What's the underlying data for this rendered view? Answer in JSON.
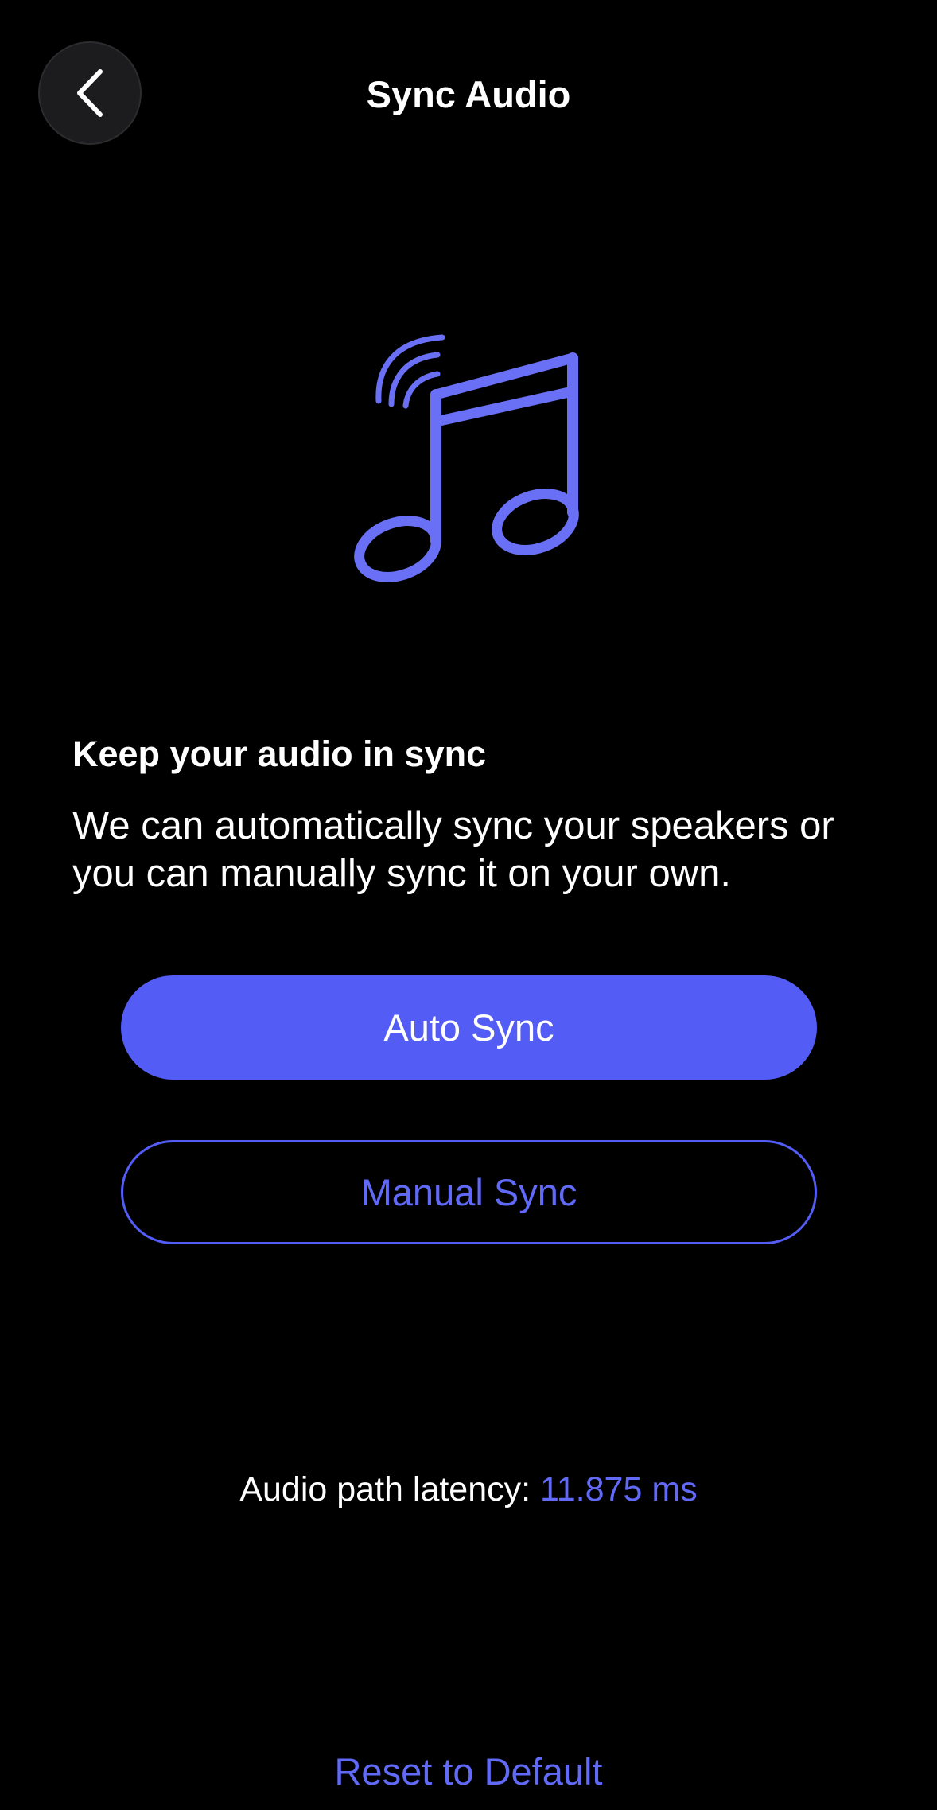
{
  "header": {
    "title": "Sync Audio",
    "back_icon": "chevron-left-icon"
  },
  "hero": {
    "icon": "music-note-sound-waves-icon",
    "accent_color": "#6A70F5"
  },
  "content": {
    "heading": "Keep your audio in sync",
    "body_line_1": "We can automatically sync your speakers or",
    "body_line_2": "you can manually sync it on your own."
  },
  "actions": {
    "auto_sync_label": "Auto Sync",
    "manual_sync_label": "Manual Sync",
    "primary_color": "#535CF5"
  },
  "latency": {
    "label": "Audio path latency:",
    "value": "11.875 ms"
  },
  "footer": {
    "reset_label": "Reset to Default"
  }
}
